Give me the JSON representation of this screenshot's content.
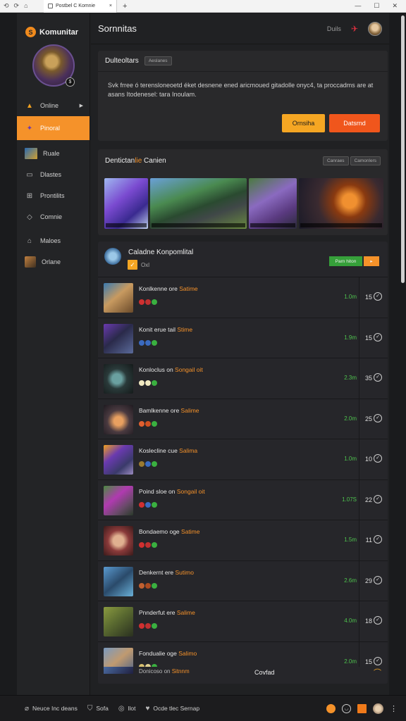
{
  "browser": {
    "tab_title": "Postbel C Komnie",
    "nav_icons": [
      "back-icon",
      "refresh-icon",
      "home-icon"
    ]
  },
  "sidebar": {
    "brand": "Komunitar",
    "items": [
      {
        "label": "Online",
        "icon": "warning-icon"
      },
      {
        "label": "Pinoral",
        "icon": "character-icon",
        "active": true
      },
      {
        "label": "Ruale",
        "icon": "game-thumb-icon"
      },
      {
        "label": "Dlastes",
        "icon": "window-icon"
      },
      {
        "label": "Prontilits",
        "icon": "grid-icon"
      },
      {
        "label": "Comnie",
        "icon": "tag-icon"
      },
      {
        "label": "Maloes",
        "icon": "building-icon"
      },
      {
        "label": "Orlane",
        "icon": "avatar-icon"
      }
    ]
  },
  "topbar": {
    "title": "Sornnitas",
    "right_text": "Duils"
  },
  "notice": {
    "title": "Dulteoltars",
    "chip": "Aeslanes",
    "message": "Svk frree ó terensloneoetd éket desnene ened aricmoued gitadolle onyc4, ta proccadms are at asans Itodenesel: tara Inoulam.",
    "button_primary": "Ornsiha",
    "button_secondary": "Datsrnd"
  },
  "gallery": {
    "title_part1": "Dentictan",
    "title_part2": "lie",
    "title_part3": " Canien",
    "chip1": "Canraes",
    "chip2": "Camonlers"
  },
  "list_panel": {
    "title": "Caladne Konpomlital",
    "sub": "Oxl",
    "button_green": "Parn hiton",
    "button_orange": "▸"
  },
  "rows": [
    {
      "name": "Konlkenne ore ",
      "hl": "Satime",
      "time": "1.0m",
      "count": "15"
    },
    {
      "name": "Konit erue tail ",
      "hl": "Stime",
      "time": "1.9m",
      "count": "15"
    },
    {
      "name": "Konloclus on ",
      "hl": "Songail oit",
      "time": "2.3m",
      "count": "35"
    },
    {
      "name": "Bamlkenne ore ",
      "hl": "Salime",
      "time": "2.0m",
      "count": "25"
    },
    {
      "name": "Koslecline cue ",
      "hl": "Salima",
      "time": "1.0m",
      "count": "10"
    },
    {
      "name": "Poind sloe on ",
      "hl": "Songail oit",
      "time": "1.07S",
      "count": "22"
    },
    {
      "name": "Bondaemo oge ",
      "hl": "Satime",
      "time": "1.5m",
      "count": "11"
    },
    {
      "name": "Denkernt ere ",
      "hl": "Sutimo",
      "time": "2.6m",
      "count": "29"
    },
    {
      "name": "Pnnderfut ere ",
      "hl": "Salime",
      "time": "4.0m",
      "count": "18"
    },
    {
      "name": "Fondualie oge ",
      "hl": "Salimo",
      "time": "2.0m",
      "count": "15"
    }
  ],
  "list_footer": {
    "partial_name": "Donicoso on ",
    "partial_hl": "Sitnnm",
    "center_text": "Covfad"
  },
  "taskbar": {
    "items": [
      {
        "label": "Neuce Inc deans",
        "icon": "leaf-icon"
      },
      {
        "label": "Sofa",
        "icon": "shield-icon"
      },
      {
        "label": "llot",
        "icon": "chat-icon"
      },
      {
        "label": "Ocde tlec Sernap",
        "icon": "heart-icon"
      }
    ]
  },
  "colors": {
    "accent": "#f5922a",
    "accent_red": "#f0561c",
    "yellow": "#f5a623",
    "green_time": "#4ec44e",
    "bg": "#202123"
  }
}
